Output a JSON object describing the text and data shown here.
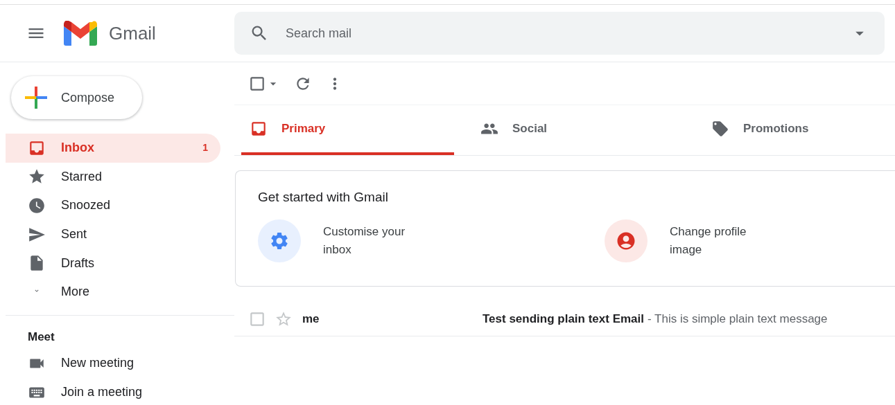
{
  "header": {
    "app_name": "Gmail",
    "search": {
      "placeholder": "Search mail"
    }
  },
  "compose": {
    "label": "Compose"
  },
  "sidebar": {
    "items": [
      {
        "kind": "inbox",
        "label": "Inbox",
        "count": "1",
        "selected": true
      },
      {
        "kind": "starred",
        "label": "Starred",
        "selected": false
      },
      {
        "kind": "snoozed",
        "label": "Snoozed",
        "selected": false
      },
      {
        "kind": "sent",
        "label": "Sent",
        "selected": false
      },
      {
        "kind": "drafts",
        "label": "Drafts",
        "selected": false
      },
      {
        "kind": "more",
        "label": "More",
        "selected": false
      }
    ],
    "meet": {
      "title": "Meet",
      "items": [
        {
          "kind": "video",
          "label": "New meeting"
        },
        {
          "kind": "keyboard",
          "label": "Join a meeting"
        }
      ]
    }
  },
  "toolbar": {
    "select_all": {
      "checked": false
    }
  },
  "tabs": [
    {
      "kind": "primary",
      "label": "Primary",
      "selected": true
    },
    {
      "kind": "social",
      "label": "Social",
      "selected": false
    },
    {
      "kind": "promotions",
      "label": "Promotions",
      "selected": false
    }
  ],
  "get_started": {
    "title": "Get started with Gmail",
    "tiles": [
      {
        "kind": "customise",
        "label": "Customise your inbox"
      },
      {
        "kind": "profile",
        "label": "Change profile image"
      }
    ]
  },
  "messages": [
    {
      "sender": "me",
      "subject": "Test sending plain text Email",
      "snippet": "- This is simple plain text message",
      "unread": true,
      "checked": false,
      "starred": false
    }
  ]
}
